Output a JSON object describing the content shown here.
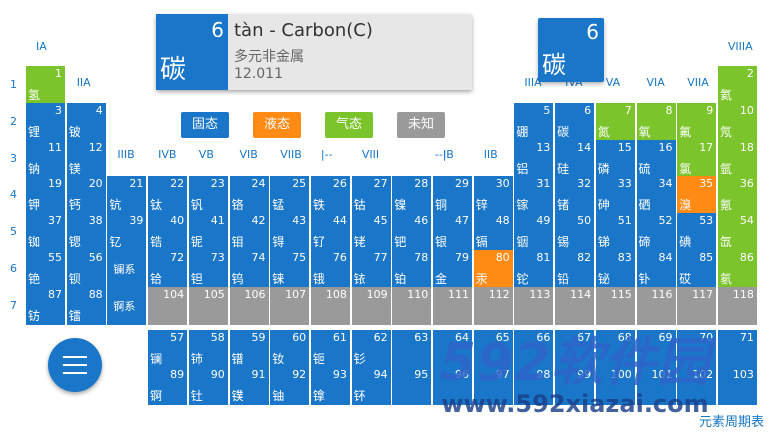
{
  "info_card": {
    "number": "6",
    "symbol": "碳",
    "name": "tàn - Carbon(C)",
    "category": "多元非金属",
    "mass": "12.011"
  },
  "big_tile": {
    "number": "6",
    "symbol": "碳"
  },
  "legend": [
    {
      "label": "固态",
      "color": "#1976c8"
    },
    {
      "label": "液态",
      "color": "#ff8a14"
    },
    {
      "label": "气态",
      "color": "#7cc42b"
    },
    {
      "label": "未知",
      "color": "#9a9a9a"
    }
  ],
  "group_labels": [
    "IA",
    "IIA",
    "IIIA",
    "IVA",
    "VA",
    "VIA",
    "VIIA",
    "VIIIA",
    "IIIB",
    "IVB",
    "VB",
    "VIB",
    "VIIB",
    "|--",
    "VIII",
    "--|",
    "IB",
    "IIB"
  ],
  "period_labels": [
    "1",
    "2",
    "3",
    "4",
    "5",
    "6",
    "7"
  ],
  "series_labels": [
    "镧系",
    "锕系"
  ],
  "elements": [
    {
      "n": "1",
      "s": "氢",
      "c": "green"
    },
    {
      "n": "2",
      "s": "氦",
      "c": "green"
    },
    {
      "n": "3",
      "s": "锂",
      "c": "blue"
    },
    {
      "n": "4",
      "s": "铍",
      "c": "blue"
    },
    {
      "n": "5",
      "s": "硼",
      "c": "blue"
    },
    {
      "n": "6",
      "s": "碳",
      "c": "blue"
    },
    {
      "n": "7",
      "s": "氮",
      "c": "green"
    },
    {
      "n": "8",
      "s": "氧",
      "c": "green"
    },
    {
      "n": "9",
      "s": "氟",
      "c": "green"
    },
    {
      "n": "10",
      "s": "氖",
      "c": "green"
    },
    {
      "n": "11",
      "s": "钠",
      "c": "blue"
    },
    {
      "n": "12",
      "s": "镁",
      "c": "blue"
    },
    {
      "n": "13",
      "s": "铝",
      "c": "blue"
    },
    {
      "n": "14",
      "s": "硅",
      "c": "blue"
    },
    {
      "n": "15",
      "s": "磷",
      "c": "blue"
    },
    {
      "n": "16",
      "s": "硫",
      "c": "blue"
    },
    {
      "n": "17",
      "s": "氯",
      "c": "green"
    },
    {
      "n": "18",
      "s": "氩",
      "c": "green"
    },
    {
      "n": "19",
      "s": "钾",
      "c": "blue"
    },
    {
      "n": "20",
      "s": "钙",
      "c": "blue"
    },
    {
      "n": "21",
      "s": "钪",
      "c": "blue"
    },
    {
      "n": "22",
      "s": "钛",
      "c": "blue"
    },
    {
      "n": "23",
      "s": "钒",
      "c": "blue"
    },
    {
      "n": "24",
      "s": "铬",
      "c": "blue"
    },
    {
      "n": "25",
      "s": "锰",
      "c": "blue"
    },
    {
      "n": "26",
      "s": "铁",
      "c": "blue"
    },
    {
      "n": "27",
      "s": "钴",
      "c": "blue"
    },
    {
      "n": "28",
      "s": "镍",
      "c": "blue"
    },
    {
      "n": "29",
      "s": "铜",
      "c": "blue"
    },
    {
      "n": "30",
      "s": "锌",
      "c": "blue"
    },
    {
      "n": "31",
      "s": "镓",
      "c": "blue"
    },
    {
      "n": "32",
      "s": "锗",
      "c": "blue"
    },
    {
      "n": "33",
      "s": "砷",
      "c": "blue"
    },
    {
      "n": "34",
      "s": "硒",
      "c": "blue"
    },
    {
      "n": "35",
      "s": "溴",
      "c": "orange"
    },
    {
      "n": "36",
      "s": "氪",
      "c": "green"
    },
    {
      "n": "37",
      "s": "铷",
      "c": "blue"
    },
    {
      "n": "38",
      "s": "锶",
      "c": "blue"
    },
    {
      "n": "39",
      "s": "钇",
      "c": "blue"
    },
    {
      "n": "40",
      "s": "锆",
      "c": "blue"
    },
    {
      "n": "41",
      "s": "铌",
      "c": "blue"
    },
    {
      "n": "42",
      "s": "钼",
      "c": "blue"
    },
    {
      "n": "43",
      "s": "锝",
      "c": "blue"
    },
    {
      "n": "44",
      "s": "钌",
      "c": "blue"
    },
    {
      "n": "45",
      "s": "铑",
      "c": "blue"
    },
    {
      "n": "46",
      "s": "钯",
      "c": "blue"
    },
    {
      "n": "47",
      "s": "银",
      "c": "blue"
    },
    {
      "n": "48",
      "s": "镉",
      "c": "blue"
    },
    {
      "n": "49",
      "s": "铟",
      "c": "blue"
    },
    {
      "n": "50",
      "s": "锡",
      "c": "blue"
    },
    {
      "n": "51",
      "s": "锑",
      "c": "blue"
    },
    {
      "n": "52",
      "s": "碲",
      "c": "blue"
    },
    {
      "n": "53",
      "s": "碘",
      "c": "blue"
    },
    {
      "n": "54",
      "s": "氙",
      "c": "green"
    },
    {
      "n": "55",
      "s": "铯",
      "c": "blue"
    },
    {
      "n": "56",
      "s": "钡",
      "c": "blue"
    },
    {
      "n": "72",
      "s": "铪",
      "c": "blue"
    },
    {
      "n": "73",
      "s": "钽",
      "c": "blue"
    },
    {
      "n": "74",
      "s": "钨",
      "c": "blue"
    },
    {
      "n": "75",
      "s": "铼",
      "c": "blue"
    },
    {
      "n": "76",
      "s": "锇",
      "c": "blue"
    },
    {
      "n": "77",
      "s": "铱",
      "c": "blue"
    },
    {
      "n": "78",
      "s": "铂",
      "c": "blue"
    },
    {
      "n": "79",
      "s": "金",
      "c": "blue"
    },
    {
      "n": "80",
      "s": "汞",
      "c": "orange"
    },
    {
      "n": "81",
      "s": "铊",
      "c": "blue"
    },
    {
      "n": "82",
      "s": "铅",
      "c": "blue"
    },
    {
      "n": "83",
      "s": "铋",
      "c": "blue"
    },
    {
      "n": "84",
      "s": "钋",
      "c": "blue"
    },
    {
      "n": "85",
      "s": "砹",
      "c": "blue"
    },
    {
      "n": "86",
      "s": "氡",
      "c": "green"
    },
    {
      "n": "87",
      "s": "钫",
      "c": "blue"
    },
    {
      "n": "88",
      "s": "镭",
      "c": "blue"
    },
    {
      "n": "104",
      "s": "",
      "c": "gray"
    },
    {
      "n": "105",
      "s": "",
      "c": "gray"
    },
    {
      "n": "106",
      "s": "",
      "c": "gray"
    },
    {
      "n": "107",
      "s": "",
      "c": "gray"
    },
    {
      "n": "108",
      "s": "",
      "c": "gray"
    },
    {
      "n": "109",
      "s": "",
      "c": "gray"
    },
    {
      "n": "110",
      "s": "",
      "c": "gray"
    },
    {
      "n": "111",
      "s": "",
      "c": "gray"
    },
    {
      "n": "112",
      "s": "",
      "c": "gray"
    },
    {
      "n": "113",
      "s": "",
      "c": "gray"
    },
    {
      "n": "114",
      "s": "",
      "c": "gray"
    },
    {
      "n": "115",
      "s": "",
      "c": "gray"
    },
    {
      "n": "116",
      "s": "",
      "c": "gray"
    },
    {
      "n": "117",
      "s": "",
      "c": "gray"
    },
    {
      "n": "118",
      "s": "",
      "c": "gray"
    },
    {
      "n": "57",
      "s": "镧",
      "c": "blue"
    },
    {
      "n": "58",
      "s": "铈",
      "c": "blue"
    },
    {
      "n": "59",
      "s": "镨",
      "c": "blue"
    },
    {
      "n": "60",
      "s": "钕",
      "c": "blue"
    },
    {
      "n": "61",
      "s": "钷",
      "c": "blue"
    },
    {
      "n": "62",
      "s": "钐",
      "c": "blue"
    },
    {
      "n": "63",
      "s": "",
      "c": "blue"
    },
    {
      "n": "64",
      "s": "",
      "c": "blue"
    },
    {
      "n": "65",
      "s": "",
      "c": "blue"
    },
    {
      "n": "66",
      "s": "",
      "c": "blue"
    },
    {
      "n": "67",
      "s": "",
      "c": "blue"
    },
    {
      "n": "68",
      "s": "",
      "c": "blue"
    },
    {
      "n": "69",
      "s": "",
      "c": "blue"
    },
    {
      "n": "70",
      "s": "",
      "c": "blue"
    },
    {
      "n": "71",
      "s": "",
      "c": "blue"
    },
    {
      "n": "89",
      "s": "锕",
      "c": "blue"
    },
    {
      "n": "90",
      "s": "钍",
      "c": "blue"
    },
    {
      "n": "91",
      "s": "镤",
      "c": "blue"
    },
    {
      "n": "92",
      "s": "铀",
      "c": "blue"
    },
    {
      "n": "93",
      "s": "镎",
      "c": "blue"
    },
    {
      "n": "94",
      "s": "钚",
      "c": "blue"
    },
    {
      "n": "95",
      "s": "",
      "c": "blue"
    },
    {
      "n": "96",
      "s": "",
      "c": "blue"
    },
    {
      "n": "97",
      "s": "",
      "c": "blue"
    },
    {
      "n": "98",
      "s": "",
      "c": "blue"
    },
    {
      "n": "99",
      "s": "",
      "c": "blue"
    },
    {
      "n": "100",
      "s": "",
      "c": "blue"
    },
    {
      "n": "101",
      "s": "",
      "c": "blue"
    },
    {
      "n": "102",
      "s": "",
      "c": "blue"
    },
    {
      "n": "103",
      "s": "",
      "c": "blue"
    }
  ],
  "element_symbols_extra": [
    "铊",
    "铅",
    "铋",
    "钋",
    "砹",
    "氡"
  ],
  "watermark": {
    "main": "592软件园",
    "sub": "www.592xiazai.com"
  },
  "footer": "元素周期表",
  "menu_button": "menu-icon"
}
